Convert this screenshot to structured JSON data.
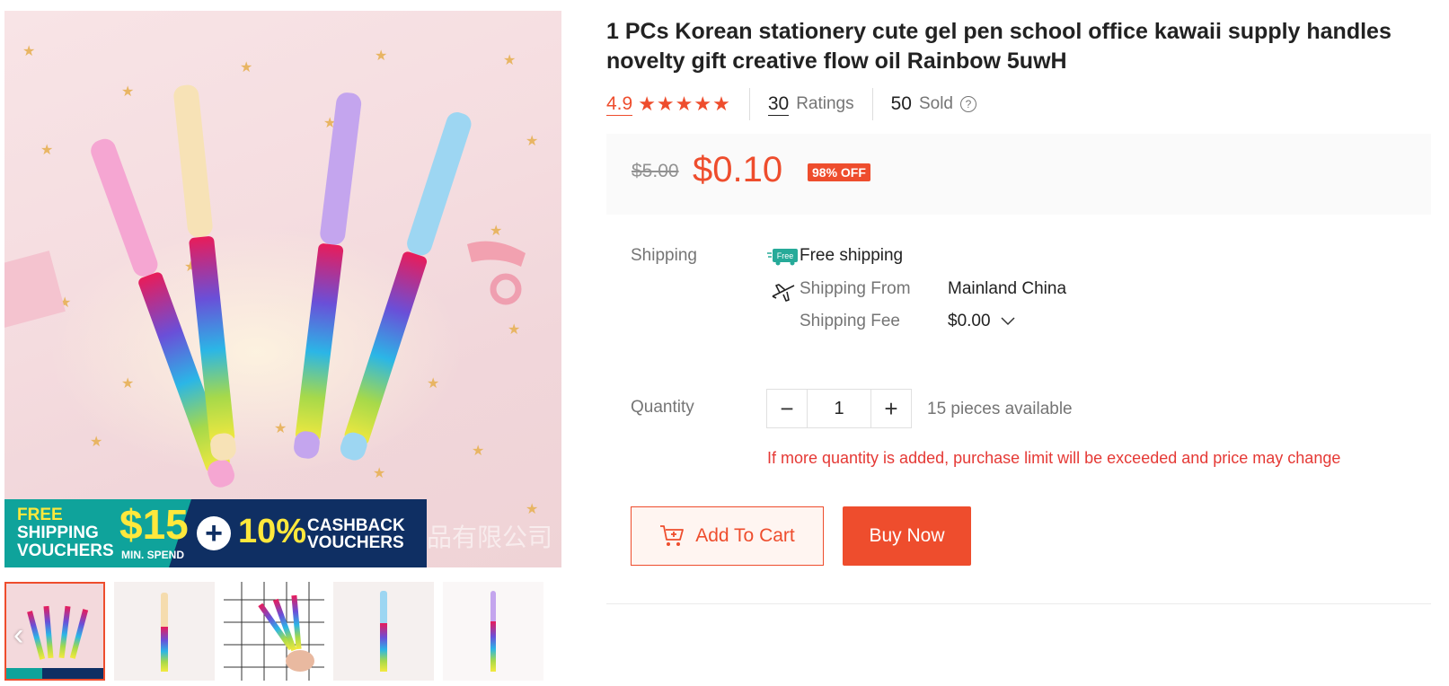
{
  "product": {
    "title": "1 PCs Korean stationery cute gel pen school office kawaii supply handles novelty gift creative flow oil Rainbow 5uwH",
    "rating": "4.9",
    "stars_filled": 5,
    "ratings_count": "30",
    "ratings_label": "Ratings",
    "sold_count": "50",
    "sold_label": "Sold",
    "help_icon": "question-circle-icon"
  },
  "price": {
    "original": "$5.00",
    "current": "$0.10",
    "discount_badge": "98% OFF"
  },
  "shipping": {
    "label": "Shipping",
    "free_icon_text": "Free",
    "free_text": "Free shipping",
    "from_label": "Shipping From",
    "from_value": "Mainland China",
    "fee_label": "Shipping Fee",
    "fee_value": "$0.00"
  },
  "quantity": {
    "label": "Quantity",
    "value": "1",
    "minus": "−",
    "plus": "+",
    "available": "15 pieces available",
    "warning": "If more quantity is added, purchase limit will be exceeded and price may change"
  },
  "actions": {
    "add_to_cart": "Add To Cart",
    "buy_now": "Buy Now"
  },
  "gallery": {
    "promo_free_line1": "FREE",
    "promo_free_line2": "SHIPPING",
    "promo_free_line3": "VOUCHERS",
    "promo_amount": "$15",
    "promo_min": "MIN. SPEND",
    "promo_plus": "+",
    "promo_percent": "10%",
    "promo_cb_line1": "CASHBACK",
    "promo_cb_line2": "VOUCHERS",
    "watermark": "品有限公司",
    "thumbnail_count": 5,
    "active_thumbnail": 1,
    "prev_arrow": "‹"
  },
  "colors": {
    "accent": "#ee4d2d",
    "warning": "#e53935",
    "price_bg": "#fafafa",
    "free_badge": "#26aa99"
  }
}
